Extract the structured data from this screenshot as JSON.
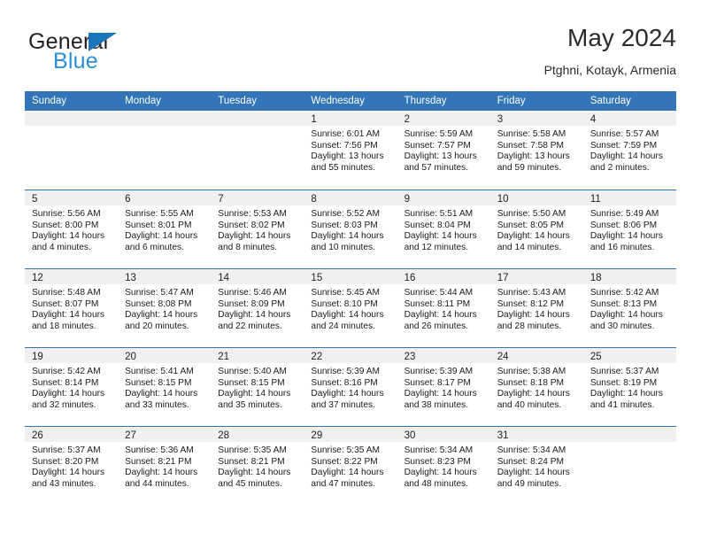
{
  "brand": {
    "name_dark": "General",
    "name_blue": "Blue",
    "triangle_color": "#1b75bb",
    "blue_color": "#2a8fd4"
  },
  "header": {
    "title": "May 2024",
    "subtitle": "Ptghni, Kotayk, Armenia"
  },
  "theme": {
    "header_blue": "#3275b9",
    "day_band_gray": "#f0f0f0",
    "text": "#1a1a1a"
  },
  "weekdays": [
    "Sunday",
    "Monday",
    "Tuesday",
    "Wednesday",
    "Thursday",
    "Friday",
    "Saturday"
  ],
  "weeks": [
    [
      {
        "day": "",
        "sunrise": "",
        "sunset": "",
        "daylight_1": "",
        "daylight_2": ""
      },
      {
        "day": "",
        "sunrise": "",
        "sunset": "",
        "daylight_1": "",
        "daylight_2": ""
      },
      {
        "day": "",
        "sunrise": "",
        "sunset": "",
        "daylight_1": "",
        "daylight_2": ""
      },
      {
        "day": "1",
        "sunrise": "Sunrise: 6:01 AM",
        "sunset": "Sunset: 7:56 PM",
        "daylight_1": "Daylight: 13 hours",
        "daylight_2": "and 55 minutes."
      },
      {
        "day": "2",
        "sunrise": "Sunrise: 5:59 AM",
        "sunset": "Sunset: 7:57 PM",
        "daylight_1": "Daylight: 13 hours",
        "daylight_2": "and 57 minutes."
      },
      {
        "day": "3",
        "sunrise": "Sunrise: 5:58 AM",
        "sunset": "Sunset: 7:58 PM",
        "daylight_1": "Daylight: 13 hours",
        "daylight_2": "and 59 minutes."
      },
      {
        "day": "4",
        "sunrise": "Sunrise: 5:57 AM",
        "sunset": "Sunset: 7:59 PM",
        "daylight_1": "Daylight: 14 hours",
        "daylight_2": "and 2 minutes."
      }
    ],
    [
      {
        "day": "5",
        "sunrise": "Sunrise: 5:56 AM",
        "sunset": "Sunset: 8:00 PM",
        "daylight_1": "Daylight: 14 hours",
        "daylight_2": "and 4 minutes."
      },
      {
        "day": "6",
        "sunrise": "Sunrise: 5:55 AM",
        "sunset": "Sunset: 8:01 PM",
        "daylight_1": "Daylight: 14 hours",
        "daylight_2": "and 6 minutes."
      },
      {
        "day": "7",
        "sunrise": "Sunrise: 5:53 AM",
        "sunset": "Sunset: 8:02 PM",
        "daylight_1": "Daylight: 14 hours",
        "daylight_2": "and 8 minutes."
      },
      {
        "day": "8",
        "sunrise": "Sunrise: 5:52 AM",
        "sunset": "Sunset: 8:03 PM",
        "daylight_1": "Daylight: 14 hours",
        "daylight_2": "and 10 minutes."
      },
      {
        "day": "9",
        "sunrise": "Sunrise: 5:51 AM",
        "sunset": "Sunset: 8:04 PM",
        "daylight_1": "Daylight: 14 hours",
        "daylight_2": "and 12 minutes."
      },
      {
        "day": "10",
        "sunrise": "Sunrise: 5:50 AM",
        "sunset": "Sunset: 8:05 PM",
        "daylight_1": "Daylight: 14 hours",
        "daylight_2": "and 14 minutes."
      },
      {
        "day": "11",
        "sunrise": "Sunrise: 5:49 AM",
        "sunset": "Sunset: 8:06 PM",
        "daylight_1": "Daylight: 14 hours",
        "daylight_2": "and 16 minutes."
      }
    ],
    [
      {
        "day": "12",
        "sunrise": "Sunrise: 5:48 AM",
        "sunset": "Sunset: 8:07 PM",
        "daylight_1": "Daylight: 14 hours",
        "daylight_2": "and 18 minutes."
      },
      {
        "day": "13",
        "sunrise": "Sunrise: 5:47 AM",
        "sunset": "Sunset: 8:08 PM",
        "daylight_1": "Daylight: 14 hours",
        "daylight_2": "and 20 minutes."
      },
      {
        "day": "14",
        "sunrise": "Sunrise: 5:46 AM",
        "sunset": "Sunset: 8:09 PM",
        "daylight_1": "Daylight: 14 hours",
        "daylight_2": "and 22 minutes."
      },
      {
        "day": "15",
        "sunrise": "Sunrise: 5:45 AM",
        "sunset": "Sunset: 8:10 PM",
        "daylight_1": "Daylight: 14 hours",
        "daylight_2": "and 24 minutes."
      },
      {
        "day": "16",
        "sunrise": "Sunrise: 5:44 AM",
        "sunset": "Sunset: 8:11 PM",
        "daylight_1": "Daylight: 14 hours",
        "daylight_2": "and 26 minutes."
      },
      {
        "day": "17",
        "sunrise": "Sunrise: 5:43 AM",
        "sunset": "Sunset: 8:12 PM",
        "daylight_1": "Daylight: 14 hours",
        "daylight_2": "and 28 minutes."
      },
      {
        "day": "18",
        "sunrise": "Sunrise: 5:42 AM",
        "sunset": "Sunset: 8:13 PM",
        "daylight_1": "Daylight: 14 hours",
        "daylight_2": "and 30 minutes."
      }
    ],
    [
      {
        "day": "19",
        "sunrise": "Sunrise: 5:42 AM",
        "sunset": "Sunset: 8:14 PM",
        "daylight_1": "Daylight: 14 hours",
        "daylight_2": "and 32 minutes."
      },
      {
        "day": "20",
        "sunrise": "Sunrise: 5:41 AM",
        "sunset": "Sunset: 8:15 PM",
        "daylight_1": "Daylight: 14 hours",
        "daylight_2": "and 33 minutes."
      },
      {
        "day": "21",
        "sunrise": "Sunrise: 5:40 AM",
        "sunset": "Sunset: 8:15 PM",
        "daylight_1": "Daylight: 14 hours",
        "daylight_2": "and 35 minutes."
      },
      {
        "day": "22",
        "sunrise": "Sunrise: 5:39 AM",
        "sunset": "Sunset: 8:16 PM",
        "daylight_1": "Daylight: 14 hours",
        "daylight_2": "and 37 minutes."
      },
      {
        "day": "23",
        "sunrise": "Sunrise: 5:39 AM",
        "sunset": "Sunset: 8:17 PM",
        "daylight_1": "Daylight: 14 hours",
        "daylight_2": "and 38 minutes."
      },
      {
        "day": "24",
        "sunrise": "Sunrise: 5:38 AM",
        "sunset": "Sunset: 8:18 PM",
        "daylight_1": "Daylight: 14 hours",
        "daylight_2": "and 40 minutes."
      },
      {
        "day": "25",
        "sunrise": "Sunrise: 5:37 AM",
        "sunset": "Sunset: 8:19 PM",
        "daylight_1": "Daylight: 14 hours",
        "daylight_2": "and 41 minutes."
      }
    ],
    [
      {
        "day": "26",
        "sunrise": "Sunrise: 5:37 AM",
        "sunset": "Sunset: 8:20 PM",
        "daylight_1": "Daylight: 14 hours",
        "daylight_2": "and 43 minutes."
      },
      {
        "day": "27",
        "sunrise": "Sunrise: 5:36 AM",
        "sunset": "Sunset: 8:21 PM",
        "daylight_1": "Daylight: 14 hours",
        "daylight_2": "and 44 minutes."
      },
      {
        "day": "28",
        "sunrise": "Sunrise: 5:35 AM",
        "sunset": "Sunset: 8:21 PM",
        "daylight_1": "Daylight: 14 hours",
        "daylight_2": "and 45 minutes."
      },
      {
        "day": "29",
        "sunrise": "Sunrise: 5:35 AM",
        "sunset": "Sunset: 8:22 PM",
        "daylight_1": "Daylight: 14 hours",
        "daylight_2": "and 47 minutes."
      },
      {
        "day": "30",
        "sunrise": "Sunrise: 5:34 AM",
        "sunset": "Sunset: 8:23 PM",
        "daylight_1": "Daylight: 14 hours",
        "daylight_2": "and 48 minutes."
      },
      {
        "day": "31",
        "sunrise": "Sunrise: 5:34 AM",
        "sunset": "Sunset: 8:24 PM",
        "daylight_1": "Daylight: 14 hours",
        "daylight_2": "and 49 minutes."
      },
      {
        "day": "",
        "sunrise": "",
        "sunset": "",
        "daylight_1": "",
        "daylight_2": ""
      }
    ]
  ]
}
